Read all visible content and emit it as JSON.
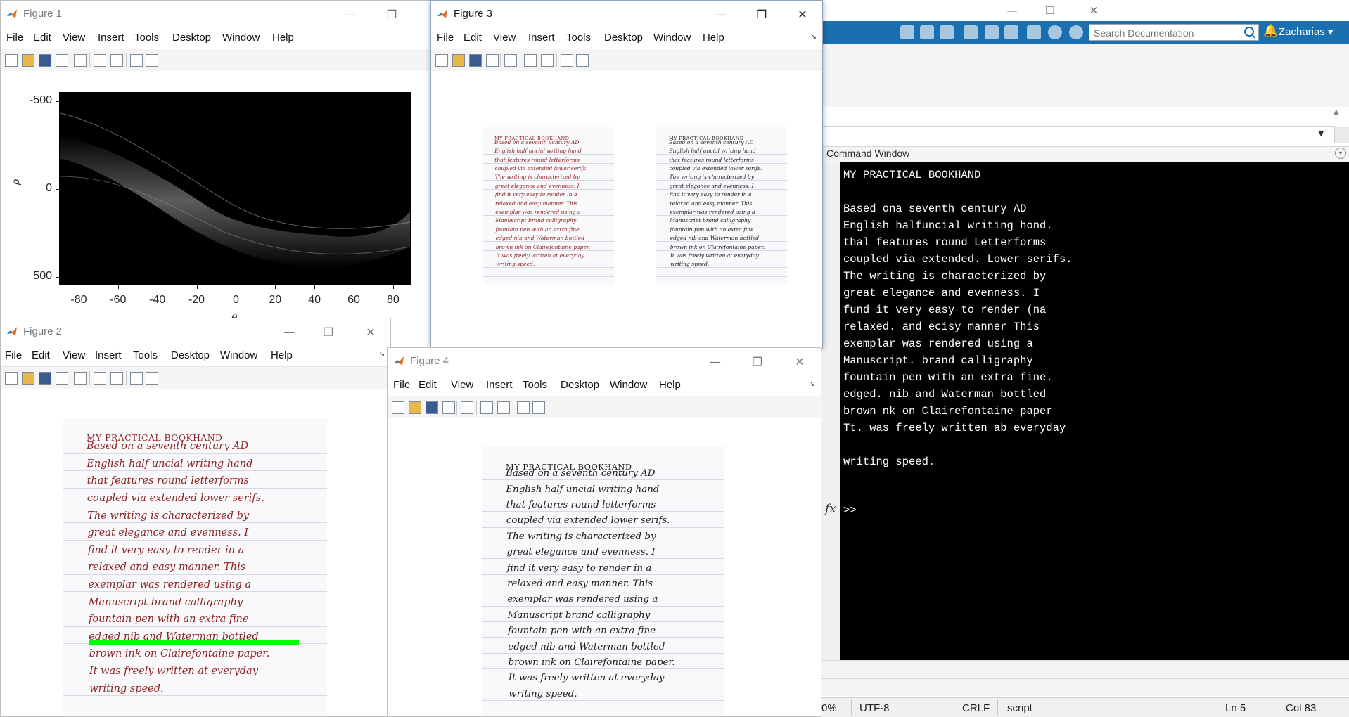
{
  "desktop": {
    "title_controls": {
      "minimize": "—",
      "maximize": "❐",
      "close": "✕"
    },
    "search": {
      "placeholder": "Search Documentation"
    },
    "user": "Zacharias",
    "command_window": {
      "title": "Command Window",
      "output": "MY PRACTICAL BOOKHAND\n\nBased ona seventh century AD\nEnglish halfuncial writing hond.\nthal features round Letterforms\ncoupled via extended. Lower serifs.\nThe writing is characterized by\ngreat elegance and evenness. I\nfund it very easy to render (na\nrelaxed. and ecisy manner This\nexemplar was rendered using a\nManuscript. brand calligraphy\nfountain pen with an extra fine.\nedged. nib and Waterman bottled\nbrown nk on Clairefontaine paper\nTt. was freely written ab everyday\n\nwriting speed.",
      "fx": "fx",
      "prompt": ">>"
    },
    "status": {
      "zoom": "0%",
      "encoding": "UTF-8",
      "line_ending": "CRLF",
      "type": "script",
      "ln": "Ln  5",
      "col": "Col  83"
    }
  },
  "figure_menu": [
    "File",
    "Edit",
    "View",
    "Insert",
    "Tools",
    "Desktop",
    "Window",
    "Help"
  ],
  "figures": {
    "fig1": {
      "title": "Figure 1"
    },
    "fig2": {
      "title": "Figure 2"
    },
    "fig3": {
      "title": "Figure 3"
    },
    "fig4": {
      "title": "Figure 4"
    }
  },
  "hough_axes": {
    "x_ticks": [
      "-80",
      "-60",
      "-40",
      "-20",
      "0",
      "20",
      "40",
      "60",
      "80"
    ],
    "y_ticks": [
      "-500",
      "0",
      "500"
    ],
    "xlabel": "θ",
    "ylabel": "ρ",
    "xlim": [
      -90,
      89
    ],
    "ylim": [
      -550,
      550
    ]
  },
  "handwriting": {
    "title": "MY PRACTICAL BOOKHAND",
    "lines": [
      "Based on a seventh century AD",
      "English half uncial writing hand",
      "that features round letterforms",
      "coupled via extended lower serifs.",
      "The writing is characterized by",
      "great elegance and evenness. I",
      "find it very easy to render in a",
      "relaxed and easy manner. This",
      "exemplar was rendered using a",
      "Manuscript brand calligraphy",
      "fountain pen with an extra fine",
      "edged nib and Waterman bottled",
      "brown ink on Clairefontaine paper.",
      "It was freely written at everyday",
      "writing speed."
    ]
  },
  "colors": {
    "accent": "#1a6fb0",
    "ink_brown": "#8b2424",
    "ink_black": "#1a1a1a",
    "highlight": "#00ff00",
    "console_bg": "#000000"
  }
}
